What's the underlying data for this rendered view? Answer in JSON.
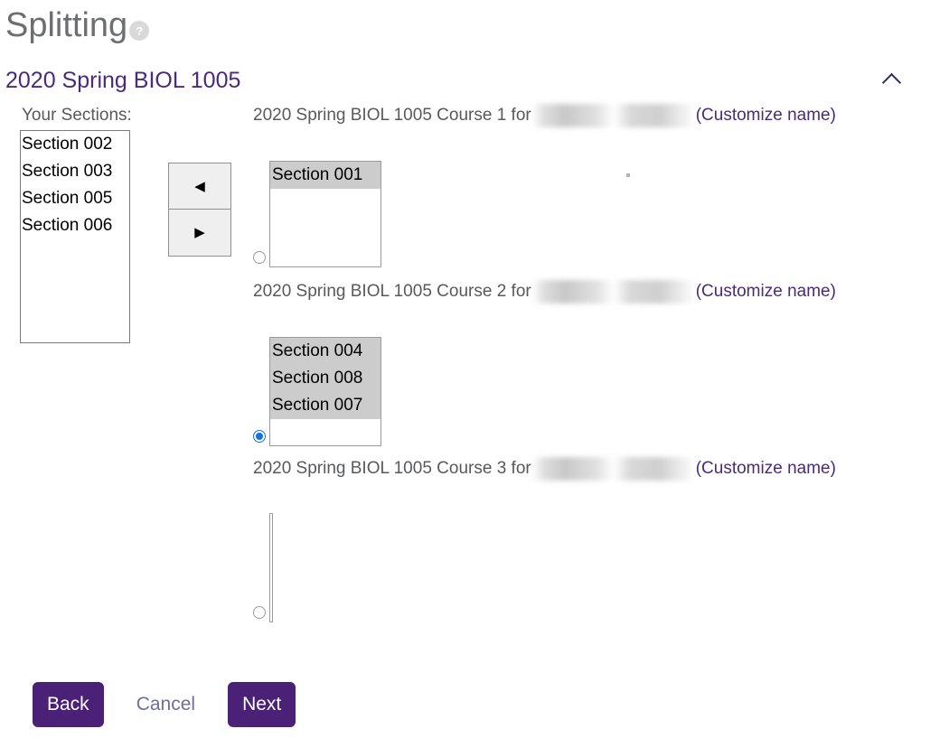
{
  "page": {
    "title": "Splitting",
    "help_icon_label": "?"
  },
  "group": {
    "title": "2020 Spring BIOL 1005",
    "collapse_icon": "chevron-up-icon"
  },
  "source": {
    "label": "Your Sections:",
    "items": [
      "Section 002",
      "Section 003",
      "Section 005",
      "Section 006"
    ]
  },
  "transfer": {
    "move_left_label": "◀",
    "move_right_label": "▶"
  },
  "courses": [
    {
      "heading_prefix": "2020 Spring BIOL 1005 Course 1 for",
      "owner_name": "",
      "customize_label": "(Customize name)",
      "selected": false,
      "items": [
        {
          "label": "Section 001",
          "selected": true
        }
      ]
    },
    {
      "heading_prefix": "2020 Spring BIOL 1005 Course 2 for",
      "owner_name": "",
      "customize_label": "(Customize name)",
      "selected": true,
      "items": [
        {
          "label": "Section 004",
          "selected": true
        },
        {
          "label": "Section 008",
          "selected": true
        },
        {
          "label": "Section 007",
          "selected": true
        }
      ]
    },
    {
      "heading_prefix": "2020 Spring BIOL 1005 Course 3 for",
      "owner_name": "",
      "customize_label": "(Customize name)",
      "selected": false,
      "items": []
    }
  ],
  "footer": {
    "back_label": "Back",
    "cancel_label": "Cancel",
    "next_label": "Next"
  },
  "colors": {
    "brand_purple": "#4b2178",
    "heading_purple": "#4b2a7b",
    "radio_blue": "#1273e6",
    "selected_gray": "#cccccc"
  }
}
